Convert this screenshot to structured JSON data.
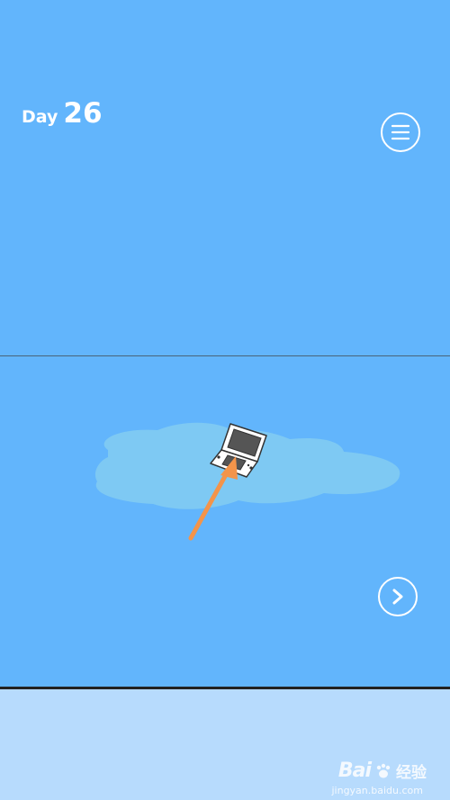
{
  "header": {
    "day_word": "Day",
    "day_number": "26"
  },
  "icons": {
    "menu": "hamburger-menu-icon",
    "next": "chevron-right-icon",
    "console": "handheld-console-icon",
    "arrow": "pointer-arrow-icon",
    "watermark": "paw-print-icon"
  },
  "colors": {
    "sky": "#62b5fc",
    "puddle": "#7ec9f3",
    "arrow": "#f3944a",
    "footer": "#b7dbfd"
  },
  "watermark": {
    "brand": "Bai",
    "cn": "经验",
    "url": "jingyan.baidu.com"
  }
}
